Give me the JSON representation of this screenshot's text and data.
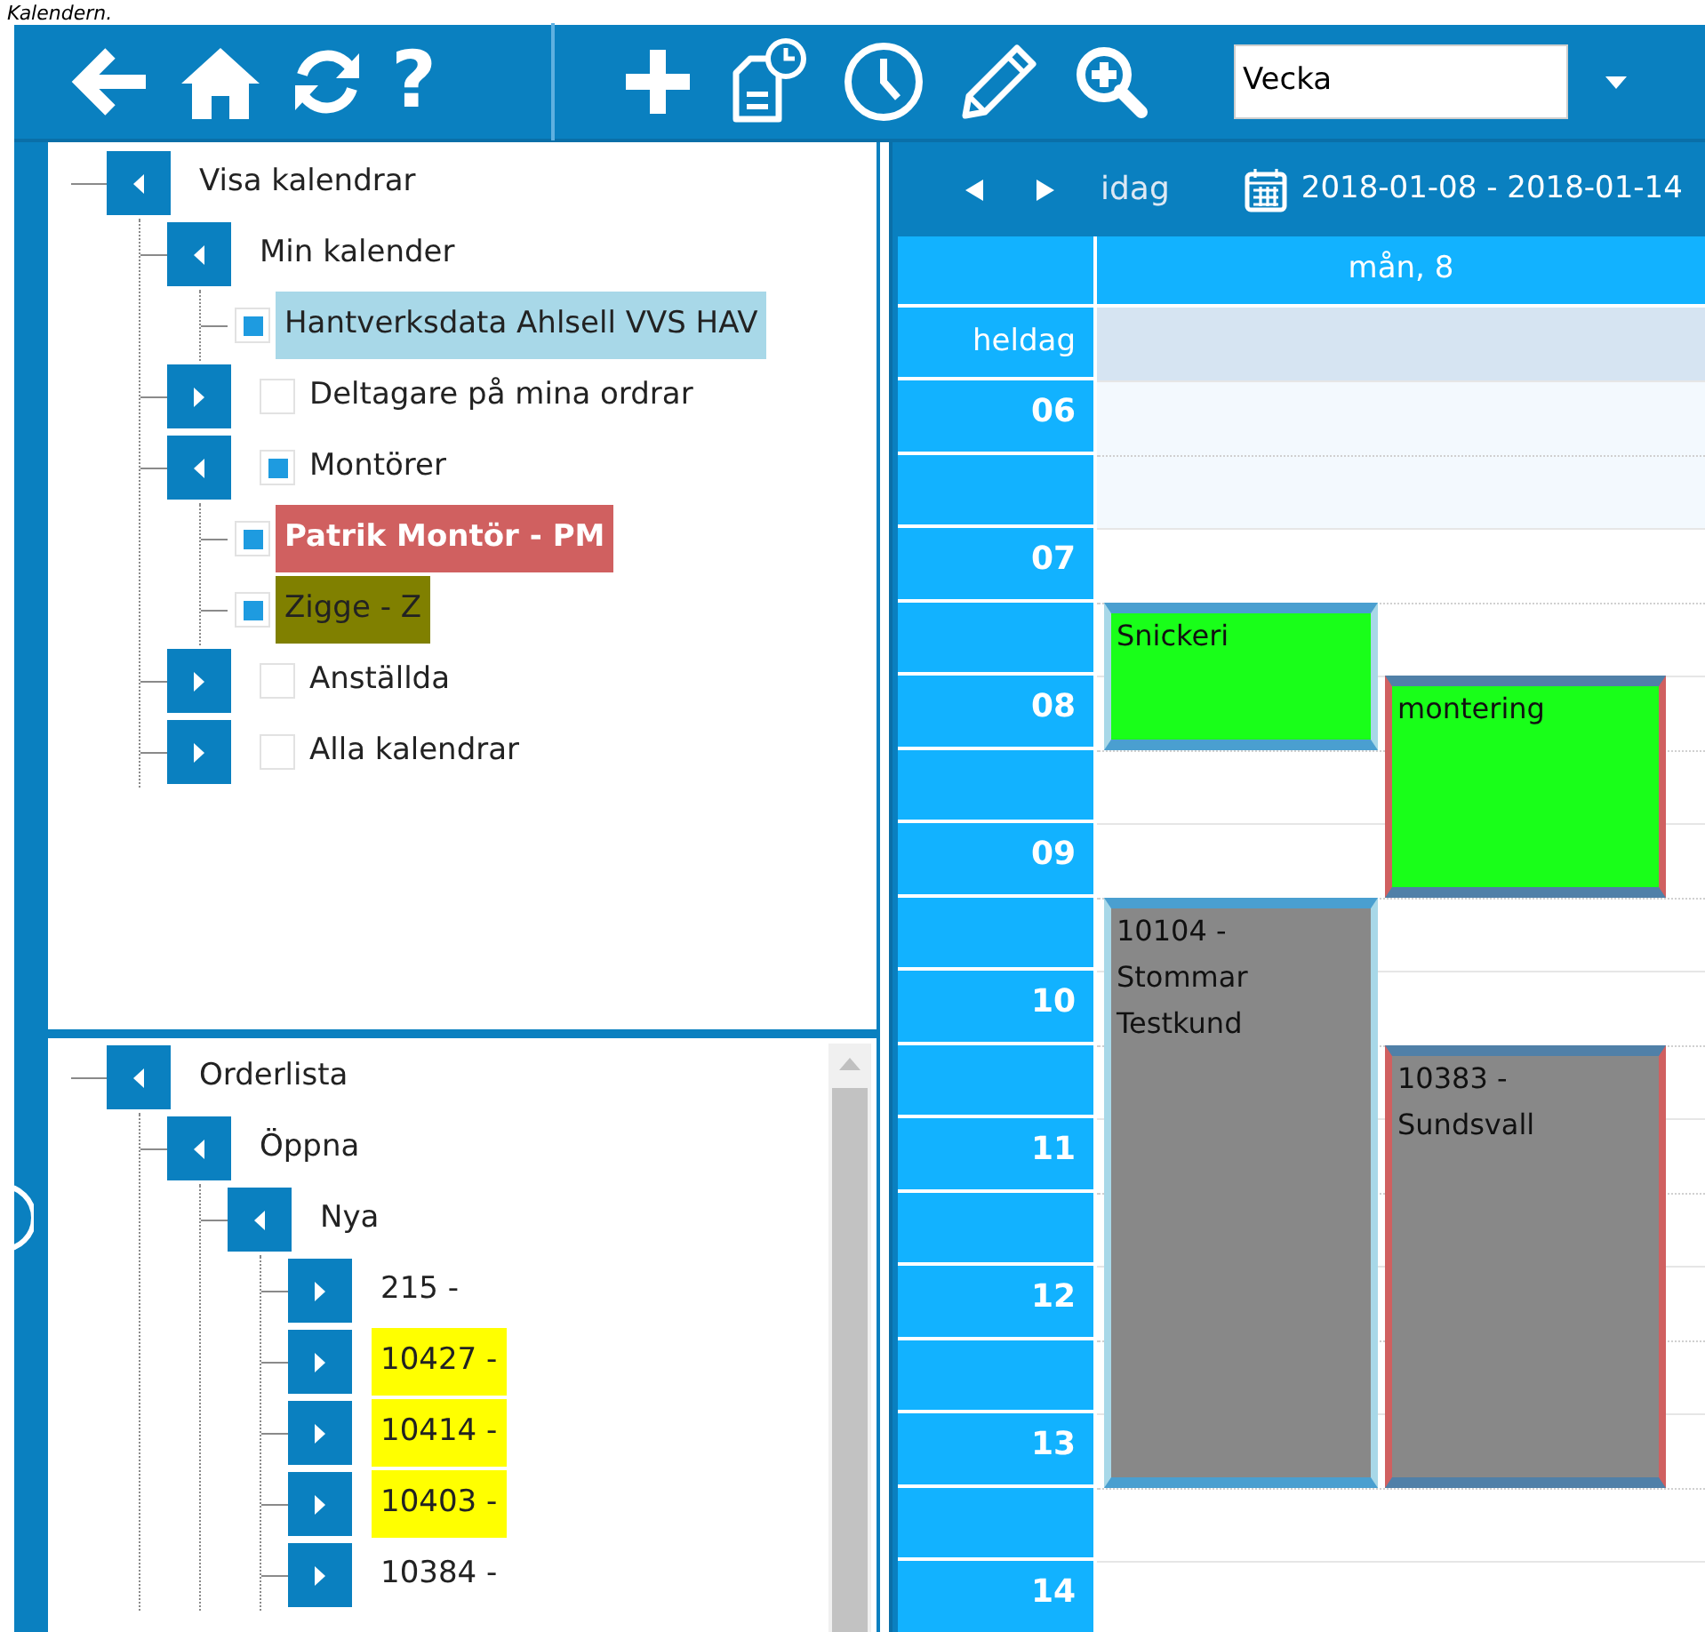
{
  "caption": "Kalendern.",
  "toolbar": {
    "help_glyph": "?",
    "view_select": {
      "value": "Vecka"
    }
  },
  "calendar_tree": [
    {
      "label": "Visa kalendrar",
      "expanded": true,
      "children": [
        {
          "label": "Min kalender",
          "expanded": true,
          "children": [
            {
              "label": "Hantverksdata Ahlsell VVS HAV",
              "checked": true,
              "color": "#a8d8e8"
            }
          ]
        },
        {
          "label": "Deltagare på mina ordrar",
          "expanded": false,
          "checked": false
        },
        {
          "label": "Montörer",
          "expanded": true,
          "checked": true,
          "children": [
            {
              "label": "Patrik Montör - PM",
              "checked": true,
              "color": "#d06060"
            },
            {
              "label": "Zigge - Z",
              "checked": true,
              "color": "#808000"
            }
          ]
        },
        {
          "label": "Anställda",
          "expanded": false,
          "checked": false
        },
        {
          "label": "Alla kalendrar",
          "expanded": false,
          "checked": false
        }
      ]
    }
  ],
  "order_tree": [
    {
      "label": "Orderlista",
      "expanded": true,
      "children": [
        {
          "label": "Öppna",
          "expanded": true,
          "children": [
            {
              "label": "Nya",
              "expanded": true,
              "children": [
                {
                  "label": "215 -",
                  "expanded": false
                },
                {
                  "label": "10427 -",
                  "expanded": false,
                  "color": "#ffff00"
                },
                {
                  "label": "10414 -",
                  "expanded": false,
                  "color": "#ffff00"
                },
                {
                  "label": "10403 -",
                  "expanded": false,
                  "color": "#ffff00"
                },
                {
                  "label": "10384 -",
                  "expanded": false
                }
              ]
            }
          ]
        }
      ]
    }
  ],
  "calendar": {
    "today_label": "idag",
    "date_range": "2018-01-08 - 2018-01-14",
    "day_header": "mån, 8",
    "all_day_label": "heldag",
    "hours": [
      "06",
      "07",
      "08",
      "09",
      "10",
      "11",
      "12",
      "13",
      "14"
    ],
    "events": [
      {
        "title": "Snickeri",
        "kind": "activity",
        "color": "#a8d8e8"
      },
      {
        "title": "montering",
        "kind": "activity",
        "color": "#d06060"
      },
      {
        "title": "10104 - Stommar Testkund",
        "kind": "order",
        "color": "#a8d8e8"
      },
      {
        "title": "10383 - Sundsvall",
        "kind": "order",
        "color": "#d06060"
      }
    ]
  }
}
